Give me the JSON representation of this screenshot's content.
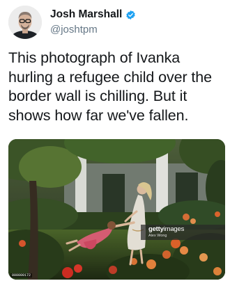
{
  "author": {
    "display_name": "Josh Marshall",
    "handle": "@joshtpm",
    "verified_icon": "verified-badge-icon",
    "verified_color": "#1da1f2"
  },
  "tweet": {
    "text": "This photograph of Ivanka\nhurling a refugee child over the\nborder wall is chilling. But it\nshows how far we've fallen."
  },
  "photo": {
    "credit_brand_prefix": "getty",
    "credit_brand_suffix": "images",
    "credit_photographer": "Alex Wong",
    "photo_id": "000000172"
  }
}
